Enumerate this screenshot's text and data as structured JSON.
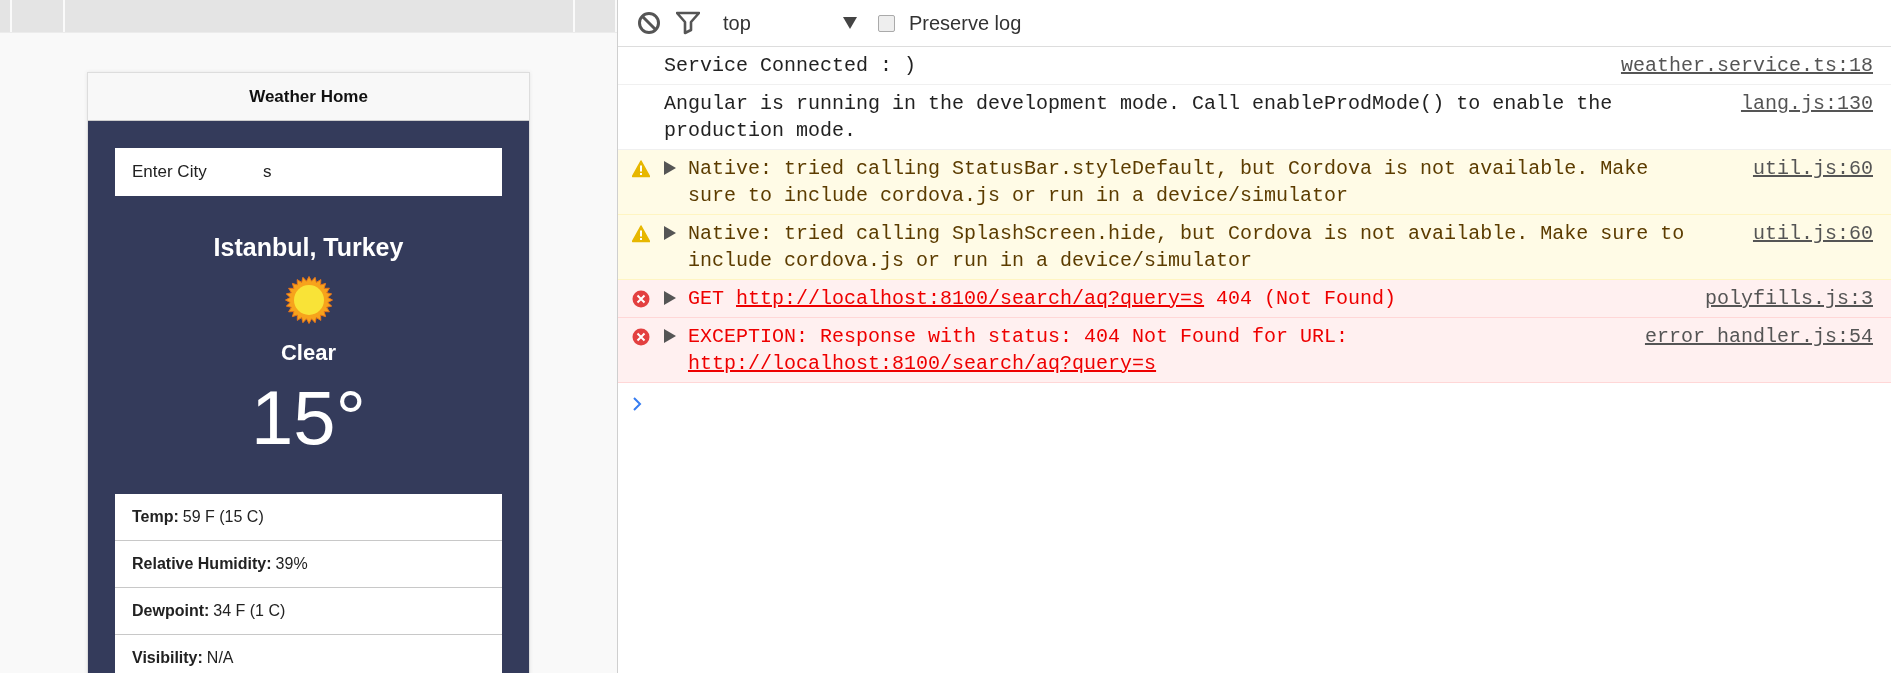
{
  "preview": {
    "header_title": "Weather Home",
    "search": {
      "label": "Enter City",
      "value": "s"
    },
    "location": "Istanbul, Turkey",
    "condition": "Clear",
    "temperature": "15°",
    "details": [
      {
        "label": "Temp:",
        "value": "59 F (15 C)"
      },
      {
        "label": "Relative Humidity:",
        "value": "39%"
      },
      {
        "label": "Dewpoint:",
        "value": "34 F (1 C)"
      },
      {
        "label": "Visibility:",
        "value": "N/A"
      }
    ]
  },
  "console": {
    "toolbar": {
      "context": "top",
      "preserve_log": {
        "label": "Preserve log",
        "checked": false
      }
    },
    "messages": [
      {
        "kind": "log",
        "expandable": false,
        "text": "Service Connected : )",
        "source": "weather.service.ts:18"
      },
      {
        "kind": "log",
        "expandable": false,
        "text": "Angular is running in the development mode. Call enableProdMode() to enable the production mode.",
        "source": "lang.js:130"
      },
      {
        "kind": "warning",
        "expandable": true,
        "text": "Native: tried calling StatusBar.styleDefault, but Cordova is not available. Make sure to include cordova.js or run in a device/simulator",
        "source": "util.js:60"
      },
      {
        "kind": "warning",
        "expandable": true,
        "text": "Native: tried calling SplashScreen.hide, but Cordova is not available. Make sure to include cordova.js or run in a device/simulator",
        "source": "util.js:60"
      },
      {
        "kind": "error",
        "expandable": true,
        "text": "GET ",
        "link": "http://localhost:8100/search/aq?query=s",
        "text_after": " 404 (Not Found)",
        "source": "polyfills.js:3"
      },
      {
        "kind": "error",
        "expandable": true,
        "text": "EXCEPTION: Response with status: 404 Not Found for URL: ",
        "link": "http://localhost:8100/search/aq?query=s",
        "source": "error_handler.js:54"
      }
    ]
  }
}
